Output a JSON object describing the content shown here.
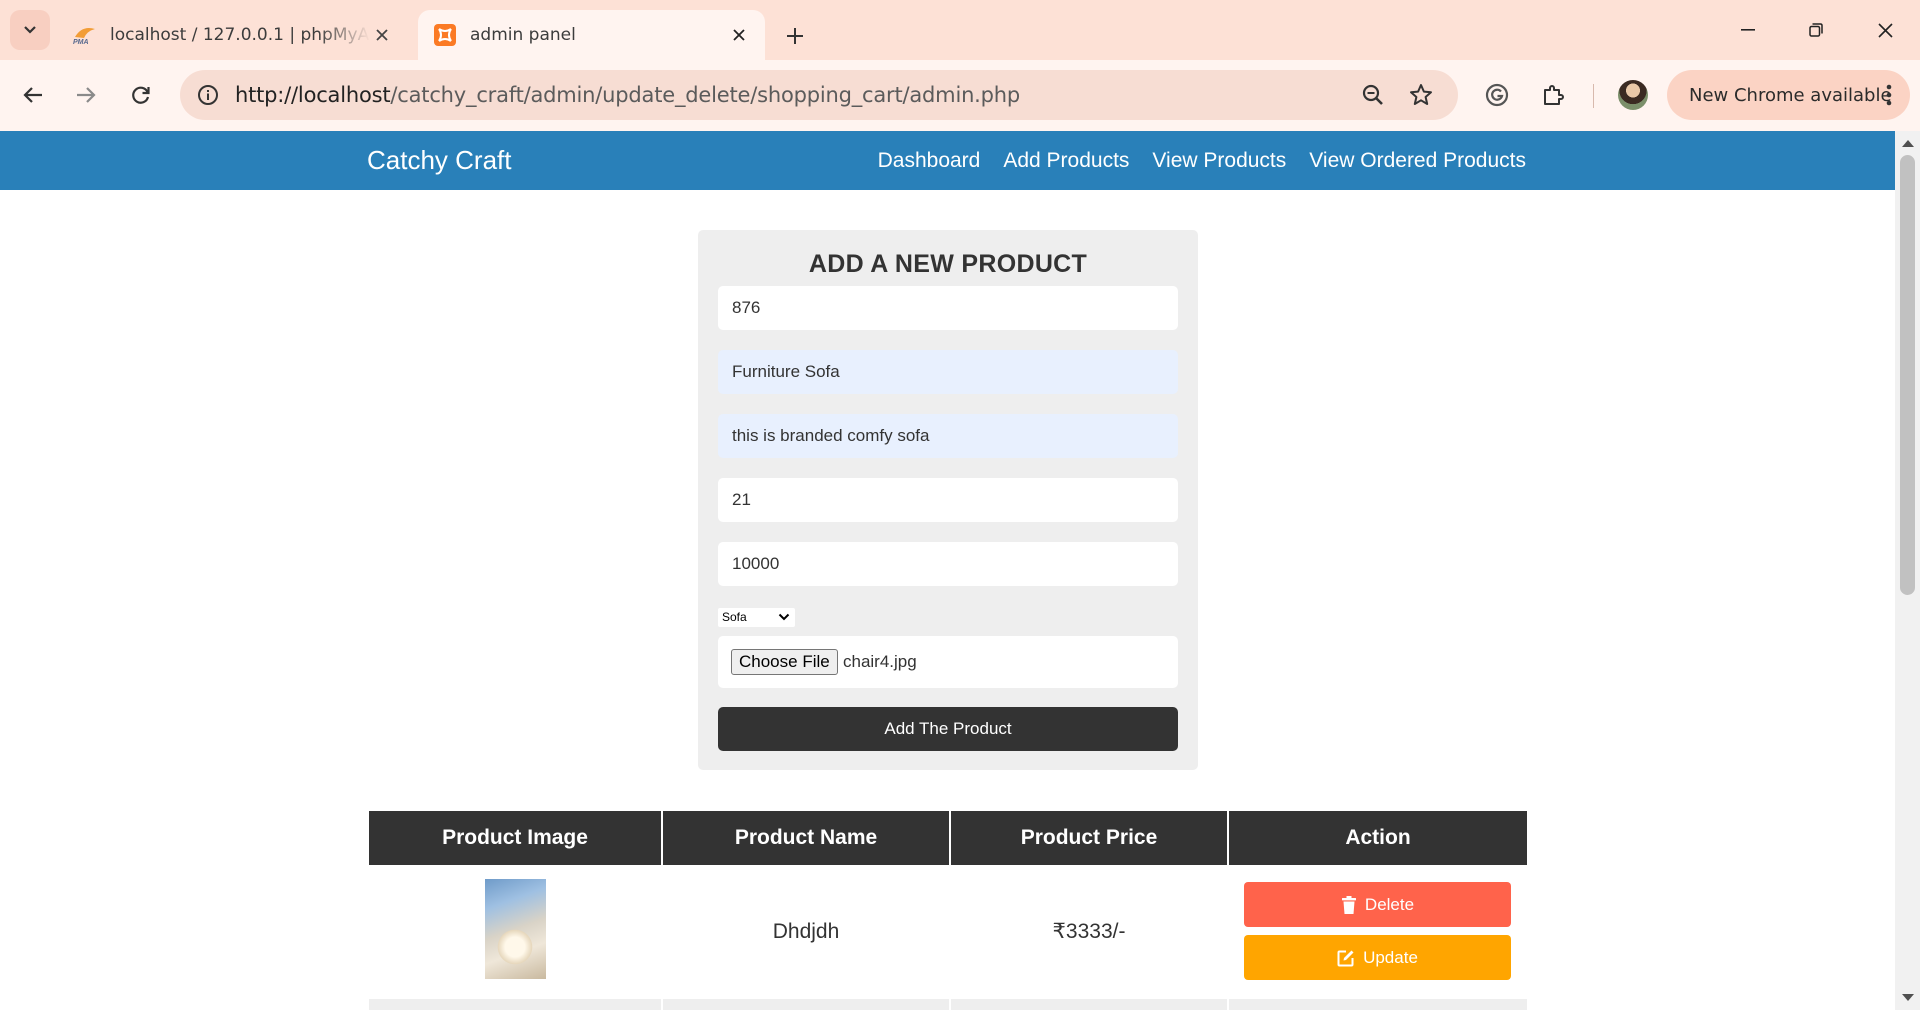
{
  "browser": {
    "tabs": [
      {
        "title": "localhost / 127.0.0.1 | phpMyAdmin",
        "favicon": "phpmyadmin-icon",
        "active": false
      },
      {
        "title": "admin panel",
        "favicon": "xampp-icon",
        "active": true
      }
    ],
    "url": {
      "host": "http://localhost",
      "path": "/catchy_craft/admin/update_delete/shopping_cart/admin.php"
    },
    "update_label": "New Chrome available"
  },
  "header": {
    "logo": "Catchy Craft",
    "nav": [
      "Dashboard",
      "Add Products",
      "View Products",
      "View Ordered Products"
    ]
  },
  "form": {
    "title": "ADD A NEW PRODUCT",
    "fields": {
      "id": "876",
      "name": "Furniture Sofa",
      "description": "this is branded comfy sofa",
      "quantity": "21",
      "price": "10000"
    },
    "category": "Sofa",
    "file_button": "Choose File",
    "file_name": "chair4.jpg",
    "submit_label": "Add The Product"
  },
  "table": {
    "headers": [
      "Product Image",
      "Product Name",
      "Product Price",
      "Action"
    ],
    "rows": [
      {
        "name": "Dhdjdh",
        "price": "₹3333/-",
        "delete_label": "Delete",
        "update_label": "Update"
      }
    ]
  },
  "colors": {
    "header": "#2980b9",
    "delete": "#ff634b",
    "update": "#ffa500",
    "dark": "#333333"
  }
}
